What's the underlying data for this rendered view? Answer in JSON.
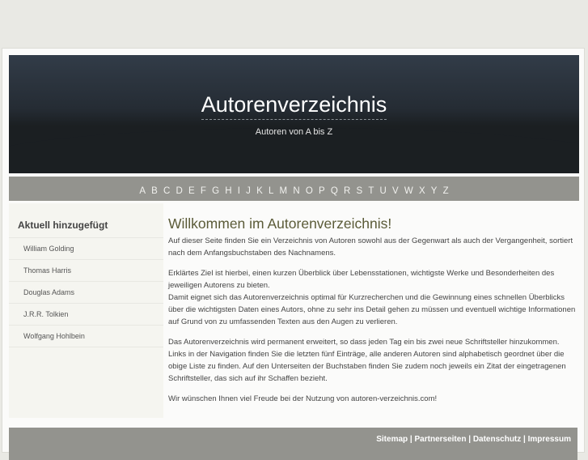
{
  "header": {
    "title": "Autorenverzeichnis",
    "subtitle": "Autoren von A bis Z"
  },
  "nav": {
    "letters": [
      "A",
      "B",
      "C",
      "D",
      "E",
      "F",
      "G",
      "H",
      "I",
      "J",
      "K",
      "L",
      "M",
      "N",
      "O",
      "P",
      "Q",
      "R",
      "S",
      "T",
      "U",
      "V",
      "W",
      "X",
      "Y",
      "Z"
    ]
  },
  "sidebar": {
    "heading": "Aktuell hinzugefügt",
    "items": [
      "William Golding",
      "Thomas Harris",
      "Douglas Adams",
      "J.R.R. Tolkien",
      "Wolfgang Hohlbein"
    ]
  },
  "main": {
    "heading": "Willkommen im Autorenverzeichnis!",
    "p1": "Auf dieser Seite finden Sie ein Verzeichnis von Autoren sowohl aus der Gegenwart als auch der Vergangenheit, sortiert nach dem Anfangsbuchstaben des Nachnamens.",
    "p2a": "Erklärtes Ziel ist hierbei, einen kurzen Überblick über Lebensstationen, wichtigste Werke und Besonderheiten des jeweiligen Autorens zu bieten.",
    "p2b": "Damit eignet sich das Autorenverzeichnis optimal für Kurzrecherchen und die Gewinnung eines schnellen Überblicks über die wichtigsten Daten eines Autors, ohne zu sehr ins Detail gehen zu müssen und eventuell wichtige Informationen auf Grund von zu umfassenden Texten aus den Augen zu verlieren.",
    "p3": "Das Autorenverzeichnis wird permanent erweitert, so dass jeden Tag ein bis zwei neue Schriftsteller hinzukommen. Links in der Navigation finden Sie die letzten fünf Einträge, alle anderen Autoren sind alphabetisch geordnet über die obige Liste zu finden. Auf den Unterseiten der Buchstaben finden Sie zudem noch jeweils ein Zitat der eingetragenen Schriftsteller, das sich auf ihr Schaffen bezieht.",
    "p4": "Wir wünschen Ihnen viel Freude bei der Nutzung von autoren-verzeichnis.com!"
  },
  "footer": {
    "links": [
      "Sitemap",
      "Partnerseiten",
      "Datenschutz",
      "Impressum"
    ],
    "sep": "|"
  }
}
